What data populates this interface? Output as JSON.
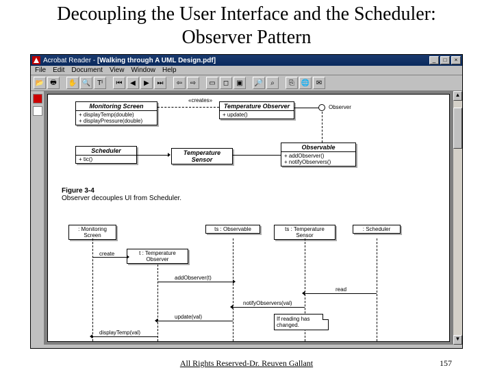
{
  "slide": {
    "title": "Decoupling the User Interface and the Scheduler: Observer Pattern",
    "footer": "All Rights Reserved-Dr. Reuven Gallant",
    "page_number": "157"
  },
  "app": {
    "name": "Acrobat Reader",
    "document": "[Walking through A UML Design.pdf]"
  },
  "menubar": [
    "File",
    "Edit",
    "Document",
    "View",
    "Window",
    "Help"
  ],
  "toolbar_icons": [
    "open-icon",
    "print-icon",
    "sep",
    "hand-icon",
    "zoom-icon",
    "text-select-icon",
    "sep",
    "first-page-icon",
    "prev-page-icon",
    "next-page-icon",
    "last-page-icon",
    "sep",
    "back-icon",
    "forward-icon",
    "sep",
    "fit-width-icon",
    "fit-page-icon",
    "actual-size-icon",
    "sep",
    "find-icon",
    "search-icon",
    "sep",
    "copy-icon",
    "web-icon",
    "mail-icon"
  ],
  "toolbar_glyphs": {
    "open-icon": "📂",
    "print-icon": "🖶",
    "hand-icon": "✋",
    "zoom-icon": "🔍",
    "text-select-icon": "Tᴵ",
    "first-page-icon": "⏮",
    "prev-page-icon": "◀",
    "next-page-icon": "▶",
    "last-page-icon": "⏭",
    "back-icon": "⇦",
    "forward-icon": "⇨",
    "fit-width-icon": "▭",
    "fit-page-icon": "◻",
    "actual-size-icon": "▣",
    "find-icon": "🔎",
    "search-icon": "⌕",
    "copy-icon": "⎘",
    "web-icon": "🌐",
    "mail-icon": "✉"
  },
  "uml": {
    "stereotype_creates": "«creates»",
    "monitoring_screen": {
      "name": "Monitoring Screen",
      "ops": "+ displayTemp(double)\n+ displayPressure(double)"
    },
    "temperature_observer": {
      "name": "Temperature Observer",
      "ops": "+ update()"
    },
    "scheduler": {
      "name": "Scheduler",
      "ops": "+ tic()"
    },
    "temperature_sensor": {
      "name": "Temperature Sensor"
    },
    "observable": {
      "name": "Observable",
      "ops": "+ addObserver()\n+ notifyObservers()"
    },
    "observer_label": "Observer",
    "figure_num": "Figure 3-4",
    "figure_text": "Observer decouples UI from Scheduler."
  },
  "seq": {
    "lifelines": {
      "monitoring": ": Monitoring Screen",
      "temp_obs": "t : Temperature Observer",
      "observable": "ts : Observable",
      "temp_sensor": "ts : Temperature Sensor",
      "scheduler": ": Scheduler"
    },
    "messages": {
      "create": "create",
      "addObserver": "addObserver(t)",
      "read": "read",
      "notify": "notifyObservers(val)",
      "update": "update(val)",
      "displayTemp": "displayTemp(val)"
    },
    "note": "If reading has changed."
  }
}
